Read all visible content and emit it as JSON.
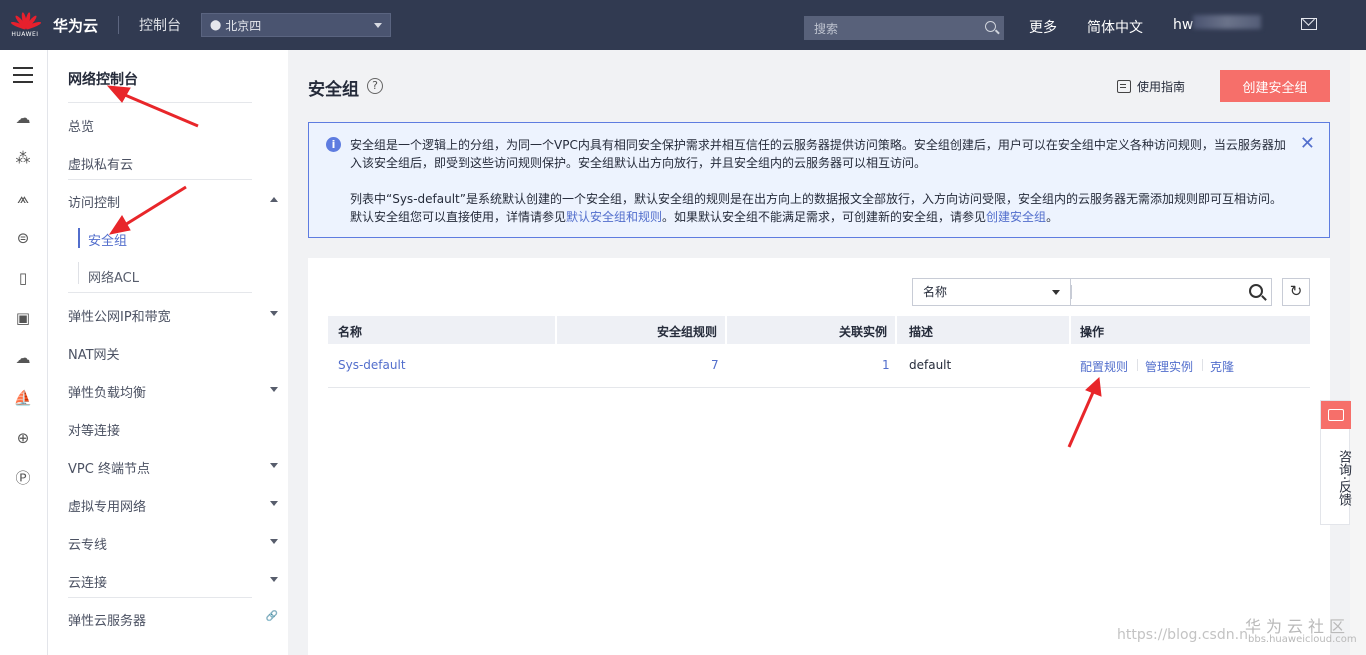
{
  "topbar": {
    "logo_text": "HUAWEI",
    "brand": "华为云",
    "console": "控制台",
    "region": "北京四",
    "search_placeholder": "搜索",
    "more": "更多",
    "language": "简体中文",
    "user": "hw"
  },
  "rail": {
    "icons": [
      "menu-icon",
      "cloud-icon",
      "cluster-icon",
      "network-icon",
      "storage-icon",
      "document-icon",
      "server-icon",
      "cloud-upload-icon",
      "sailboat-icon",
      "globe-icon",
      "ip-icon"
    ]
  },
  "sidebar": {
    "title": "网络控制台",
    "items": [
      {
        "label": "总览"
      },
      {
        "label": "虚拟私有云"
      },
      {
        "label": "访问控制"
      },
      {
        "label": "安全组"
      },
      {
        "label": "网络ACL"
      },
      {
        "label": "弹性公网IP和带宽"
      },
      {
        "label": "NAT网关"
      },
      {
        "label": "弹性负载均衡"
      },
      {
        "label": "对等连接"
      },
      {
        "label": "VPC 终端节点"
      },
      {
        "label": "虚拟专用网络"
      },
      {
        "label": "云专线"
      },
      {
        "label": "云连接"
      },
      {
        "label": "弹性云服务器"
      }
    ]
  },
  "main": {
    "title": "安全组",
    "guide": "使用指南",
    "create_button": "创建安全组",
    "notice": {
      "p1": "安全组是一个逻辑上的分组，为同一个VPC内具有相同安全保护需求并相互信任的云服务器提供访问策略。安全组创建后，用户可以在安全组中定义各种访问规则，当云服务器加入该安全组后，即受到这些访问规则保护。安全组默认出方向放行，并且安全组内的云服务器可以相互访问。",
      "p2_pre": "列表中“Sys-default”是系统默认创建的一个安全组，默认安全组的规则是在出方向上的数据报文全部放行，入方向访问受限，安全组内的云服务器无需添加规则即可互相访问。默认安全组您可以直接使用，详情请参见",
      "p2_link1": "默认安全组和规则",
      "p2_mid": "。如果默认安全组不能满足需求，可创建新的安全组，请参见",
      "p2_link2": "创建安全组",
      "p2_end": "。"
    },
    "filter": {
      "select": "名称",
      "input_value": ""
    },
    "table": {
      "headers": [
        "名称",
        "安全组规则",
        "关联实例",
        "描述",
        "操作"
      ],
      "rows": [
        {
          "name": "Sys-default",
          "rules": "7",
          "instances": "1",
          "description": "default",
          "ops": [
            "配置规则",
            "管理实例",
            "克隆"
          ]
        }
      ]
    }
  },
  "consult": {
    "label": "咨询·反馈"
  },
  "watermark": {
    "csdn": "https://blog.csdn.n",
    "community": "华为云社区",
    "bbs": "bbs.huaweicloud.com"
  },
  "colors": {
    "topbar": "#313a51",
    "accent": "#526ecc",
    "create_button": "#f66f6a",
    "notice_bg": "#edf3fe",
    "annotation_arrow": "#e8262a"
  }
}
